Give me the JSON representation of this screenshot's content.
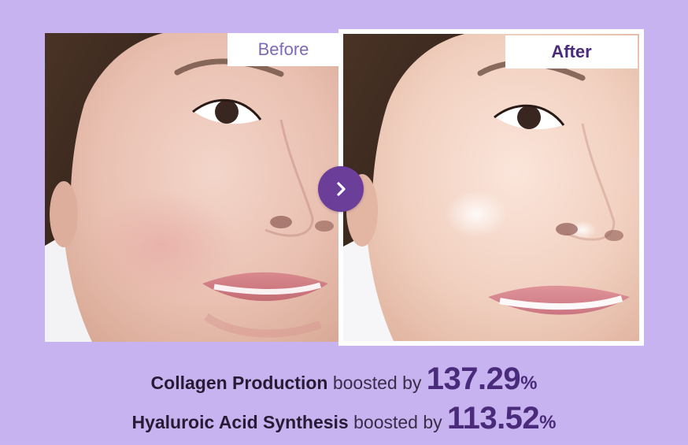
{
  "labels": {
    "before": "Before",
    "after": "After"
  },
  "arrow_icon": "chevron-right-icon",
  "colors": {
    "background": "#c6b3ef",
    "accent": "#4a2a7a",
    "arrow_button": "#6b3f99",
    "before_label": "#7f69b6"
  },
  "stats": [
    {
      "name": "Collagen Production",
      "connector": "boosted by",
      "value": "137.29",
      "unit": "%"
    },
    {
      "name": "Hyaluroic Acid Synthesis",
      "connector": "boosted by",
      "value": "113.52",
      "unit": "%"
    }
  ]
}
